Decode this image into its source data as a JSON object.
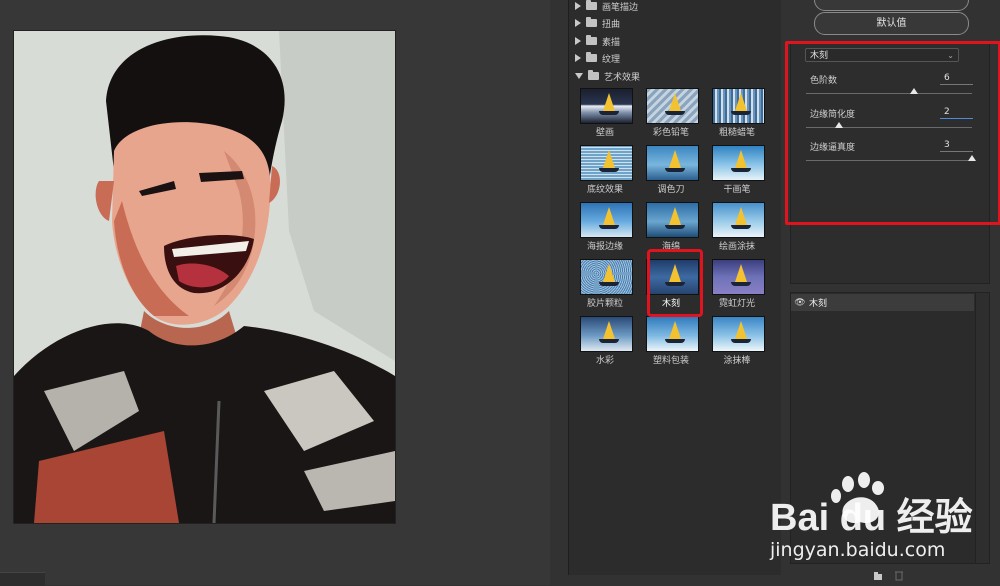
{
  "gallery": {
    "categories": [
      {
        "label": "画笔描边",
        "open": false
      },
      {
        "label": "扭曲",
        "open": false
      },
      {
        "label": "素描",
        "open": false
      },
      {
        "label": "纹理",
        "open": false
      },
      {
        "label": "艺术效果",
        "open": true
      }
    ],
    "filters": [
      {
        "label": "壁画",
        "style": "dark"
      },
      {
        "label": "彩色铅笔",
        "style": "pencil"
      },
      {
        "label": "粗糙蜡笔",
        "style": "crayon"
      },
      {
        "label": "底纹效果",
        "style": "texture"
      },
      {
        "label": "调色刀",
        "style": "knife"
      },
      {
        "label": "干画笔",
        "style": "dry"
      },
      {
        "label": "海报边缘",
        "style": "poster"
      },
      {
        "label": "海绵",
        "style": "sponge"
      },
      {
        "label": "绘画涂抹",
        "style": "smudge"
      },
      {
        "label": "胶片颗粒",
        "style": "grain"
      },
      {
        "label": "木刻",
        "style": "cutout"
      },
      {
        "label": "霓虹灯光",
        "style": "neon"
      },
      {
        "label": "水彩",
        "style": "watercolor"
      },
      {
        "label": "塑料包装",
        "style": "plastic"
      },
      {
        "label": "涂抹棒",
        "style": "stick"
      }
    ],
    "selected_filter": "木刻"
  },
  "settings": {
    "default_button": "默认值",
    "filter_select": "木刻",
    "params": [
      {
        "label": "色阶数",
        "value": "6",
        "level": 0.65
      },
      {
        "label": "边缘简化度",
        "value": "2",
        "level": 0.2
      },
      {
        "label": "边缘逼真度",
        "value": "3",
        "level": 1.0
      }
    ]
  },
  "layers": [
    {
      "name": "木刻",
      "visible": true
    }
  ],
  "watermark": {
    "brand_text": "Bai du 经验",
    "url": "jingyan.baidu.com"
  },
  "colors": {
    "highlight": "#e0141e",
    "panel_bg": "#323232",
    "input_focus": "#4a8bdc"
  }
}
